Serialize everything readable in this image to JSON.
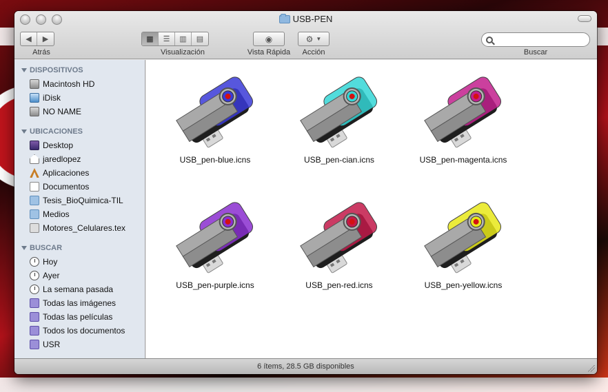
{
  "window": {
    "title": "USB-PEN"
  },
  "toolbar": {
    "back_label": "Atrás",
    "view_label": "Visualización",
    "quicklook_label": "Vista Rápida",
    "action_label": "Acción",
    "search_label": "Buscar",
    "search_placeholder": "",
    "search_value": ""
  },
  "sidebar": {
    "sections": [
      {
        "title": "DISPOSITIVOS",
        "items": [
          {
            "label": "Macintosh HD",
            "icon": "hard-drive-icon"
          },
          {
            "label": "iDisk",
            "icon": "idisk-icon"
          },
          {
            "label": "NO NAME",
            "icon": "hard-drive-icon"
          }
        ]
      },
      {
        "title": "UBICACIONES",
        "items": [
          {
            "label": "Desktop",
            "icon": "desktop-icon"
          },
          {
            "label": "jaredlopez",
            "icon": "home-icon"
          },
          {
            "label": "Aplicaciones",
            "icon": "applications-icon"
          },
          {
            "label": "Documentos",
            "icon": "documents-icon"
          },
          {
            "label": "Tesis_BioQuimica-TIL",
            "icon": "folder-icon"
          },
          {
            "label": "Medios",
            "icon": "folder-icon"
          },
          {
            "label": "Motores_Celulares.tex",
            "icon": "tex-file-icon"
          }
        ]
      },
      {
        "title": "BUSCAR",
        "items": [
          {
            "label": "Hoy",
            "icon": "clock-icon"
          },
          {
            "label": "Ayer",
            "icon": "clock-icon"
          },
          {
            "label": "La semana pasada",
            "icon": "clock-icon"
          },
          {
            "label": "Todas las imágenes",
            "icon": "smart-folder-icon"
          },
          {
            "label": "Todas las películas",
            "icon": "smart-folder-icon"
          },
          {
            "label": "Todos los documentos",
            "icon": "smart-folder-icon"
          },
          {
            "label": "USR",
            "icon": "smart-folder-icon"
          }
        ]
      }
    ]
  },
  "files": [
    {
      "name": "USB_pen-blue.icns",
      "color": "#3a3ad8"
    },
    {
      "name": "USB_pen-cian.icns",
      "color": "#34d6d6"
    },
    {
      "name": "USB_pen-magenta.icns",
      "color": "#c21f8e"
    },
    {
      "name": "USB_pen-purple.icns",
      "color": "#8a2fd0"
    },
    {
      "name": "USB_pen-red.icns",
      "color": "#c21a4a"
    },
    {
      "name": "USB_pen-yellow.icns",
      "color": "#e8e81a"
    }
  ],
  "statusbar": {
    "text": "6 ítems, 28.5 GB disponibles"
  }
}
